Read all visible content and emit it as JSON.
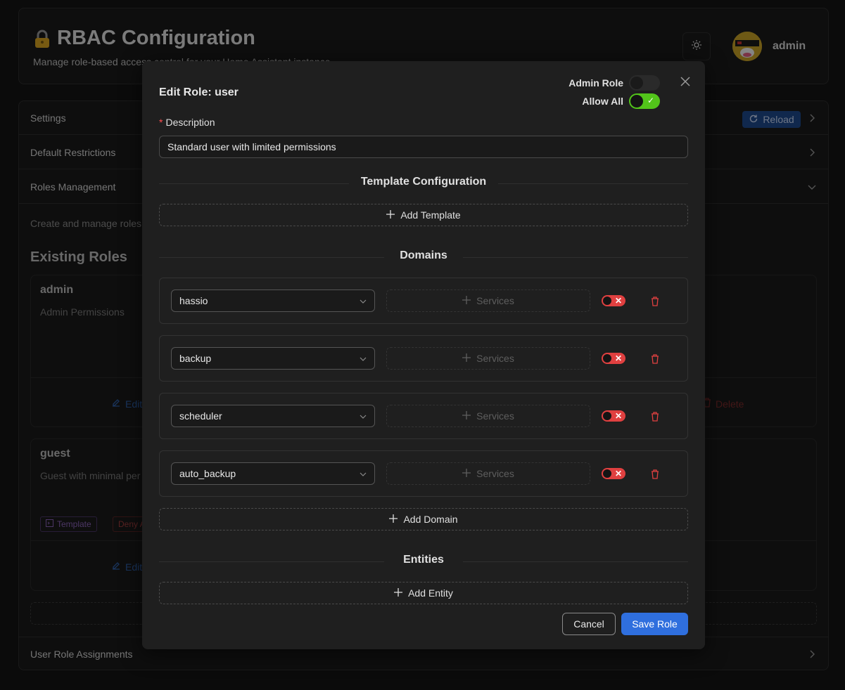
{
  "header": {
    "title": "RBAC Configuration",
    "subtitle": "Manage role-based access control for your Home Assistant instance",
    "user_name": "admin"
  },
  "panels": {
    "settings": "Settings",
    "reload_label": "Reload",
    "default_restrictions": "Default Restrictions",
    "roles_management": "Roles Management",
    "user_role_assignments": "User Role Assignments"
  },
  "roles_section": {
    "description": "Create and manage roles",
    "heading": "Existing Roles",
    "roles": [
      {
        "name": "admin",
        "description": "Admin Permissions",
        "edit_label": "Edit",
        "delete_label": "Delete"
      },
      {
        "name": "guest",
        "description": "Guest with minimal per",
        "edit_label": "Edit",
        "tags": [
          "Template",
          "Deny A"
        ]
      }
    ]
  },
  "modal": {
    "title": "Edit Role: user",
    "admin_role_label": "Admin Role",
    "admin_role_on": false,
    "allow_all_label": "Allow All",
    "allow_all_on": true,
    "description_label": "Description",
    "description_value": "Standard user with limited permissions",
    "template_section": "Template Configuration",
    "add_template": "Add Template",
    "domains_section": "Domains",
    "domains": [
      {
        "name": "hassio",
        "services_label": "Services"
      },
      {
        "name": "backup",
        "services_label": "Services"
      },
      {
        "name": "scheduler",
        "services_label": "Services"
      },
      {
        "name": "auto_backup",
        "services_label": "Services"
      }
    ],
    "add_domain": "Add Domain",
    "entities_section": "Entities",
    "add_entity": "Add Entity",
    "cancel": "Cancel",
    "save": "Save Role"
  },
  "colors": {
    "primary": "#2f6fde",
    "success": "#52c41a",
    "danger": "#e04040",
    "background": "#141414"
  }
}
